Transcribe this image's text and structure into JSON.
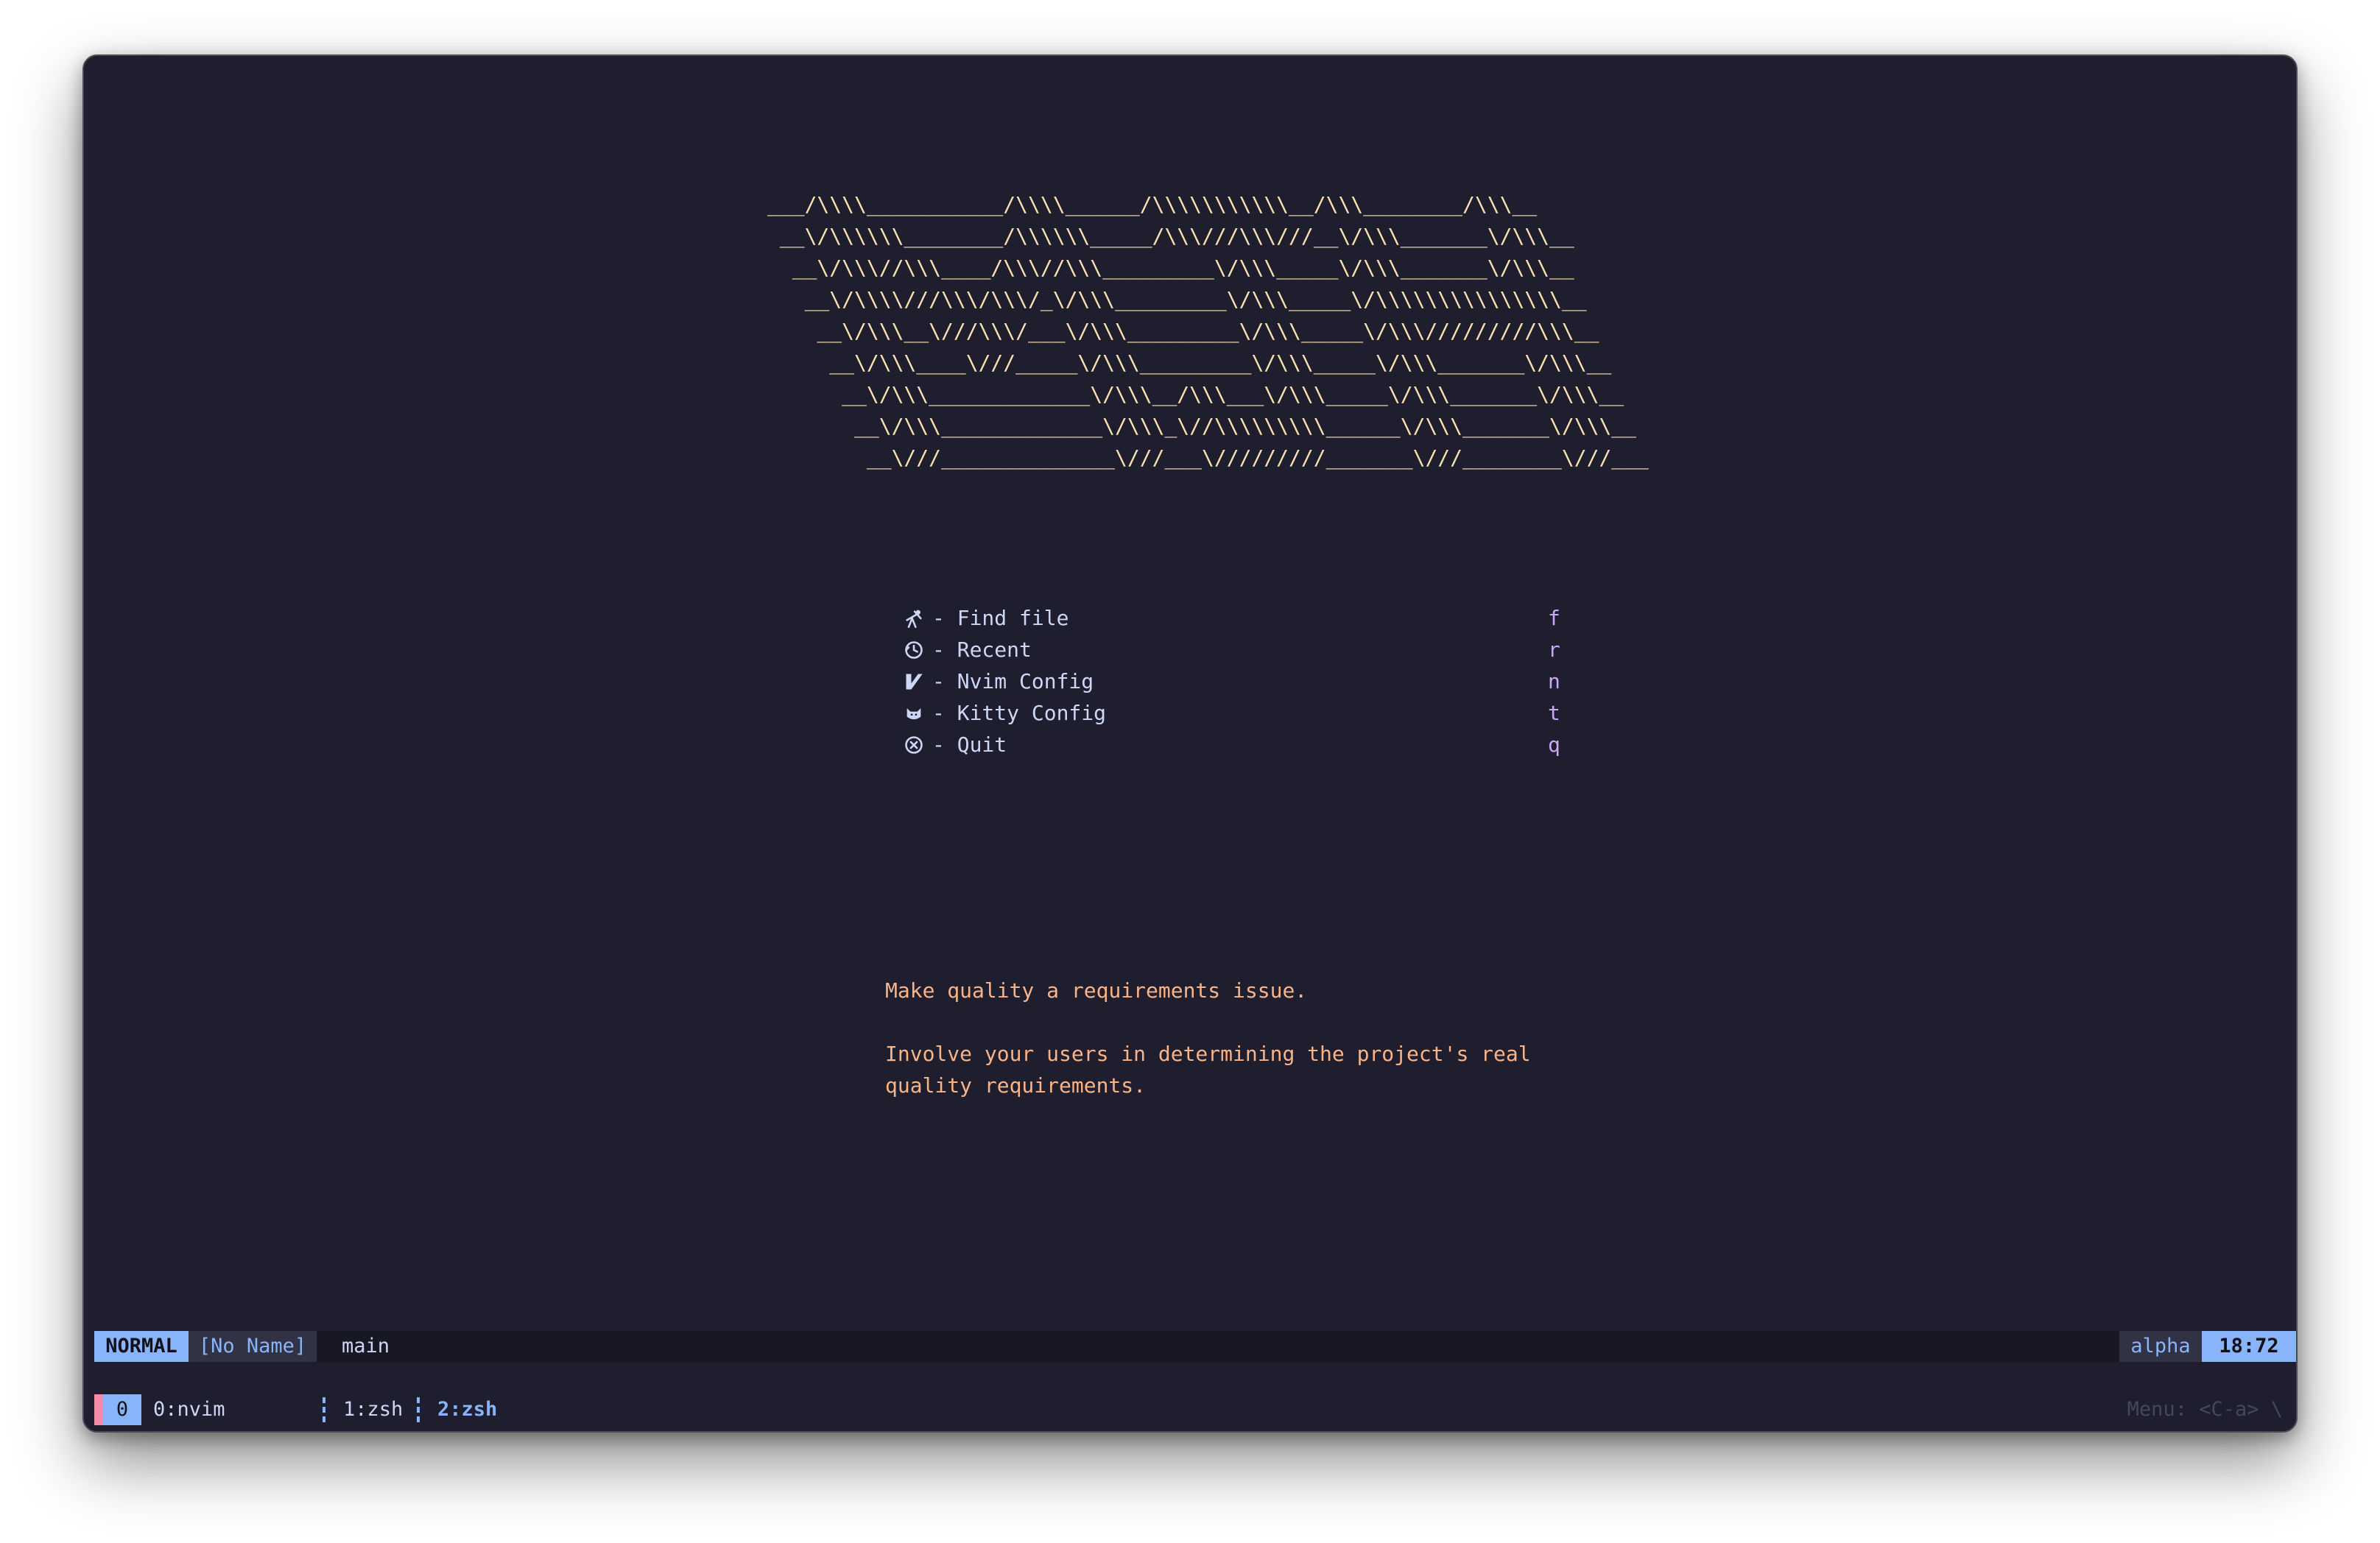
{
  "banner": {
    "lines": [
      "___/\\\\\\\\___________/\\\\\\\\______/\\\\\\\\\\\\\\\\\\\\\\__/\\\\\\________/\\\\\\__",
      " __\\/\\\\\\\\\\\\________/\\\\\\\\\\\\_____/\\\\\\///\\\\\\///__\\/\\\\\\_______\\/\\\\\\__",
      "  __\\/\\\\\\//\\\\\\____/\\\\\\//\\\\\\_________\\/\\\\\\_____\\/\\\\\\_______\\/\\\\\\__",
      "   __\\/\\\\\\\\///\\\\\\/\\\\\\/_\\/\\\\\\_________\\/\\\\\\_____\\/\\\\\\\\\\\\\\\\\\\\\\\\\\\\\\__",
      "    __\\/\\\\\\__\\///\\\\\\/___\\/\\\\\\_________\\/\\\\\\_____\\/\\\\\\/////////\\\\\\__",
      "     __\\/\\\\\\____\\///_____\\/\\\\\\_________\\/\\\\\\_____\\/\\\\\\_______\\/\\\\\\__",
      "      __\\/\\\\\\_____________\\/\\\\\\__/\\\\\\___\\/\\\\\\_____\\/\\\\\\_______\\/\\\\\\__",
      "       __\\/\\\\\\_____________\\/\\\\\\_\\//\\\\\\\\\\\\\\\\\\______\\/\\\\\\_______\\/\\\\\\__",
      "        __\\///______________\\///___\\/////////_______\\///________\\///___"
    ]
  },
  "menu": {
    "items": [
      {
        "icon": "telescope-icon",
        "label": "- Find file",
        "key": "f"
      },
      {
        "icon": "history-icon",
        "label": "- Recent",
        "key": "r"
      },
      {
        "icon": "vim-icon",
        "label": "- Nvim Config",
        "key": "n"
      },
      {
        "icon": "cat-icon",
        "label": "- Kitty Config",
        "key": "t"
      },
      {
        "icon": "close-circle-icon",
        "label": "- Quit",
        "key": "q"
      }
    ]
  },
  "quote": {
    "line1": "Make quality a requirements issue.",
    "line2": "Involve your users in determining the project's real",
    "line3": "quality requirements."
  },
  "statusline": {
    "mode": "NORMAL",
    "filename": "[No Name]",
    "branch": "main",
    "filetype": "alpha",
    "position": "18:72"
  },
  "tmux": {
    "session": "0",
    "windows": [
      "0:nvim",
      "1:zsh",
      "2:zsh"
    ],
    "active_window": "2:zsh",
    "menu_hint": "Menu: <C-a> \\"
  },
  "colors": {
    "background": "#1e1e2e",
    "banner": "#f9e2af",
    "accent": "#89b4fa",
    "keys": "#cba6f7",
    "quote": "#fab387",
    "session_marker": "#f38ba8"
  }
}
